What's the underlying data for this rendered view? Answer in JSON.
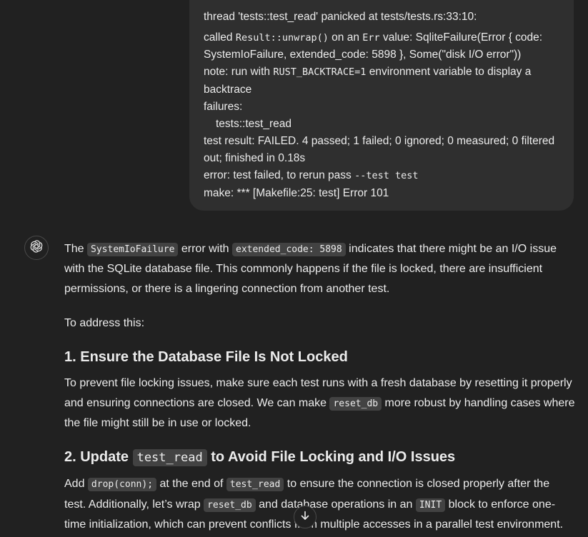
{
  "user_message": {
    "line0": "thread 'tests::test_read' panicked at tests/tests.rs:33:10:",
    "line1_pre": "called ",
    "line1_code": "Result::unwrap()",
    "line1_mid": " on an ",
    "line1_code2": "Err",
    "line1_post": " value: SqliteFailure(Error { code:",
    "line2": "SystemIoFailure, extended_code: 5898 }, Some(\"disk I/O error\"))",
    "line3_pre": "note: run with ",
    "line3_code": "RUST_BACKTRACE=1",
    "line3_post": " environment variable to display a",
    "line4": "backtrace",
    "line5": "failures:",
    "line6": "tests::test_read",
    "line7": "test result: FAILED. 4 passed; 1 failed; 0 ignored; 0 measured; 0 filtered",
    "line8": "out; finished in 0.18s",
    "line9_pre": "error: test failed, to rerun pass ",
    "line9_code": "--test test",
    "line10": "make: *** [Makefile:25: test] Error 101"
  },
  "assistant": {
    "p1": {
      "a": "The ",
      "code1": "SystemIoFailure",
      "b": " error with ",
      "code2": "extended_code: 5898",
      "c": " indicates that there might be an I/O issue",
      "line2": "with the SQLite database file. This commonly happens if the file is locked, there are insufficient",
      "line3": "permissions, or there is a lingering connection from another test."
    },
    "p2": "To address this:",
    "h1": "1. Ensure the Database File Is Not Locked",
    "p3": {
      "line1": "To prevent file locking issues, make sure each test runs with a fresh database by resetting it properly",
      "line2_a": "and ensuring connections are closed. We can make ",
      "line2_code": "reset_db",
      "line2_b": " more robust by handling cases where",
      "line3": "the file might still be in use or locked."
    },
    "h2": {
      "a": "2. Update ",
      "code": "test_read",
      "b": " to Avoid File Locking and I/O Issues"
    },
    "p4": {
      "line1_a": "Add ",
      "line1_code1": "drop(conn);",
      "line1_b": " at the end of ",
      "line1_code2": "test_read",
      "line1_c": " to ensure the connection is closed properly after the",
      "line2_a": "test. Additionally, let’s wrap ",
      "line2_code1": "reset_db",
      "line2_b": " and database operations in an ",
      "line2_code2": "INIT",
      "line2_c": " block to enforce one-",
      "line3": "time initialization, which can prevent conflicts from multiple accesses in a parallel test environment."
    }
  },
  "icons": {
    "avatar": "openai-logo-icon",
    "scroll": "arrow-down-icon"
  }
}
